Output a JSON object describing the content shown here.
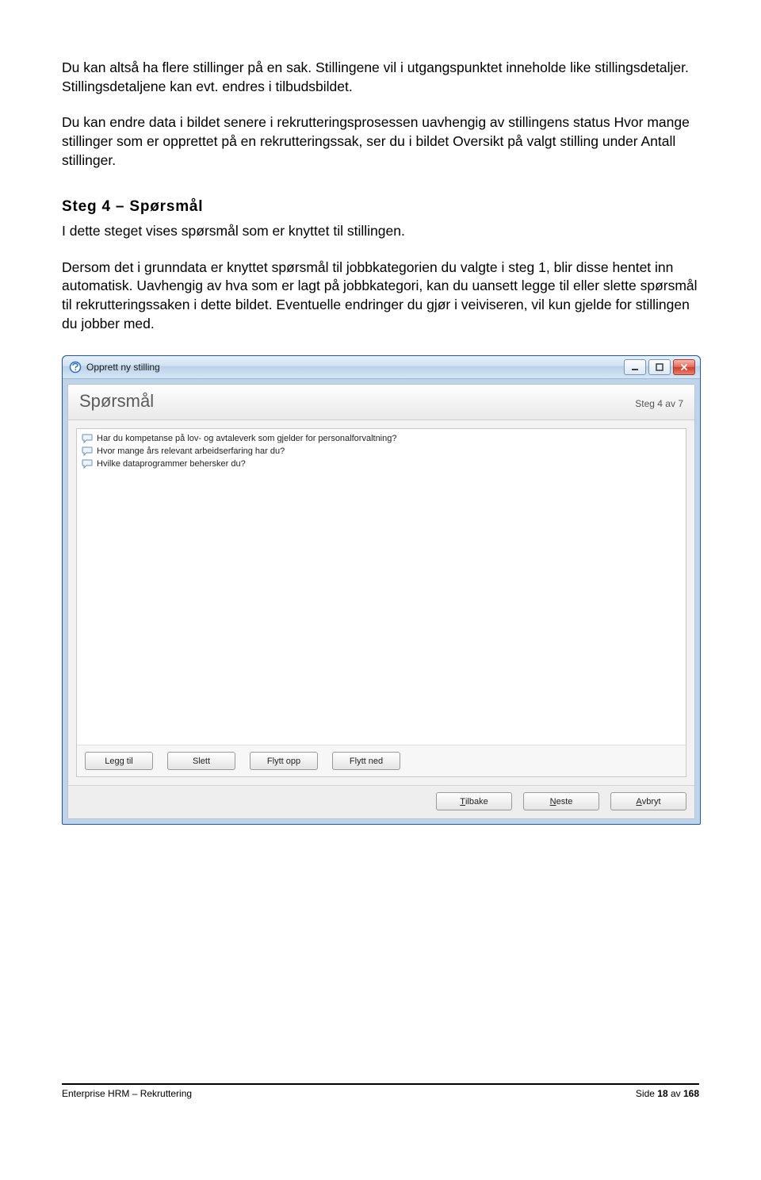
{
  "doc": {
    "para1": "Du kan altså ha flere stillinger på en sak. Stillingene vil i utgangspunktet inneholde like stillingsdetaljer. Stillingsdetaljene kan evt. endres i tilbudsbildet.",
    "para2": "Du kan endre data i bildet senere i rekrutteringsprosessen uavhengig av stillingens status Hvor mange stillinger som er opprettet på en rekrutteringssak, ser du i bildet Oversikt på valgt stilling under Antall stillinger.",
    "heading": "Steg 4 – Spørsmål",
    "para3": "I dette steget vises spørsmål som er knyttet til stillingen.",
    "para4": "Dersom det i grunndata er knyttet spørsmål til jobbkategorien du valgte i steg 1, blir disse hentet inn automatisk. Uavhengig av hva som er lagt på jobbkategori, kan du uansett legge til eller slette spørsmål til rekrutteringssaken i dette bildet. Eventuelle endringer du gjør i veiviseren, vil kun gjelde for stillingen du jobber med."
  },
  "window": {
    "title": "Opprett ny stilling",
    "section_title": "Spørsmål",
    "step_label": "Steg 4 av 7",
    "questions": [
      "Har du kompetanse på lov- og avtaleverk som gjelder for personalforvaltning?",
      "Hvor mange års relevant arbeidserfaring har du?",
      "Hvilke dataprogrammer behersker du?"
    ],
    "panel_buttons": {
      "add": "Legg til",
      "delete": "Slett",
      "move_up": "Flytt opp",
      "move_down": "Flytt ned"
    },
    "footer_buttons": {
      "back_mnem": "T",
      "back_rest": "ilbake",
      "next_mnem": "N",
      "next_rest": "este",
      "cancel_mnem": "A",
      "cancel_rest": "vbryt"
    }
  },
  "footer": {
    "left": "Enterprise HRM – Rekruttering",
    "right_prefix": "Side ",
    "page_current": "18",
    "right_mid": " av ",
    "page_total": "168"
  }
}
